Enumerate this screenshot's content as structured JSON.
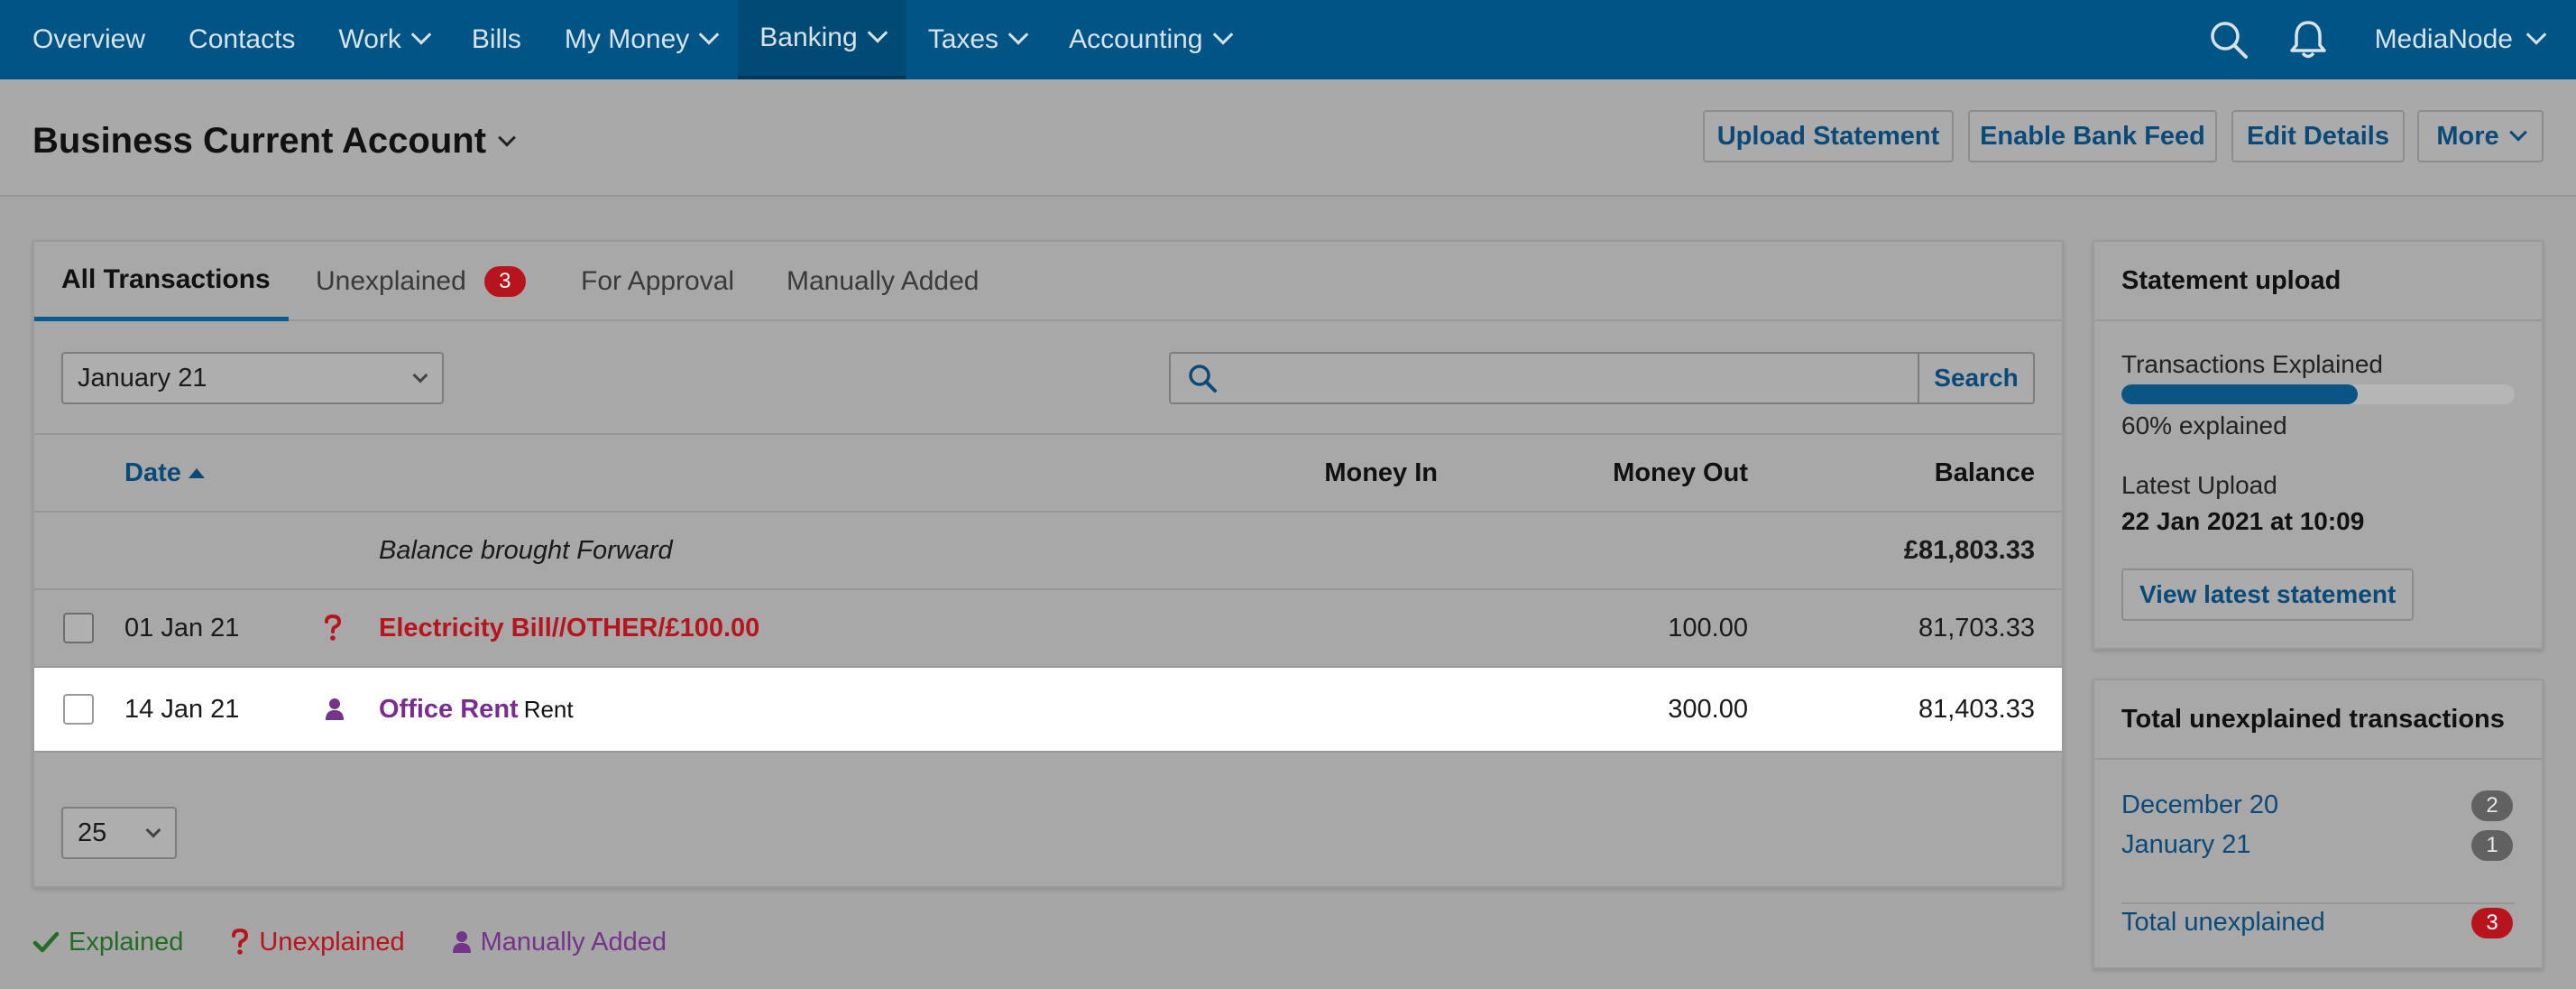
{
  "nav": {
    "items": [
      {
        "label": "Overview",
        "dropdown": false
      },
      {
        "label": "Contacts",
        "dropdown": false
      },
      {
        "label": "Work",
        "dropdown": true
      },
      {
        "label": "Bills",
        "dropdown": false
      },
      {
        "label": "My Money",
        "dropdown": true
      },
      {
        "label": "Banking",
        "dropdown": true,
        "active": true
      },
      {
        "label": "Taxes",
        "dropdown": true
      },
      {
        "label": "Accounting",
        "dropdown": true
      }
    ],
    "account": "MediaNode",
    "icons": [
      "search-icon",
      "bell-icon"
    ]
  },
  "header": {
    "title": "Business Current Account",
    "buttons": {
      "upload": "Upload Statement",
      "feed": "Enable Bank Feed",
      "edit": "Edit Details",
      "more": "More"
    }
  },
  "tabs": {
    "all": "All Transactions",
    "unexplained": "Unexplained",
    "unexplained_count": "3",
    "approval": "For Approval",
    "manual": "Manually Added"
  },
  "filters": {
    "month": "January 21",
    "search_placeholder": "",
    "search_button": "Search"
  },
  "table": {
    "headers": {
      "date": "Date",
      "money_in": "Money In",
      "money_out": "Money Out",
      "balance": "Balance"
    },
    "brought_forward": {
      "label": "Balance brought Forward",
      "balance": "£81,803.33"
    },
    "rows": [
      {
        "date": "01 Jan 21",
        "status": "unexplained",
        "description": "Electricity Bill//OTHER/£100.00",
        "sub": "",
        "money_in": "",
        "money_out": "100.00",
        "balance": "81,703.33"
      },
      {
        "date": "14 Jan 21",
        "status": "manual",
        "description": "Office Rent",
        "sub": "Rent",
        "money_in": "",
        "money_out": "300.00",
        "balance": "81,403.33"
      }
    ],
    "per_page": "25"
  },
  "legend": {
    "explained": "Explained",
    "unexplained": "Unexplained",
    "manual": "Manually Added"
  },
  "statement_upload": {
    "title": "Statement upload",
    "progress_label": "Transactions Explained",
    "progress_fraction": 0.6,
    "progress_text": "60% explained",
    "latest_label": "Latest Upload",
    "latest_value": "22 Jan 2021 at 10:09",
    "view_button": "View latest statement"
  },
  "unexplained_panel": {
    "title": "Total unexplained transactions",
    "months": [
      {
        "label": "December 20",
        "count": "2"
      },
      {
        "label": "January 21",
        "count": "1"
      }
    ],
    "total_label": "Total unexplained",
    "total_count": "3"
  },
  "colors": {
    "nav_bg": "#005486",
    "accent": "#0a4a78",
    "unexplained": "#b8141d",
    "manual": "#7a2d8f",
    "explained": "#236c23"
  }
}
